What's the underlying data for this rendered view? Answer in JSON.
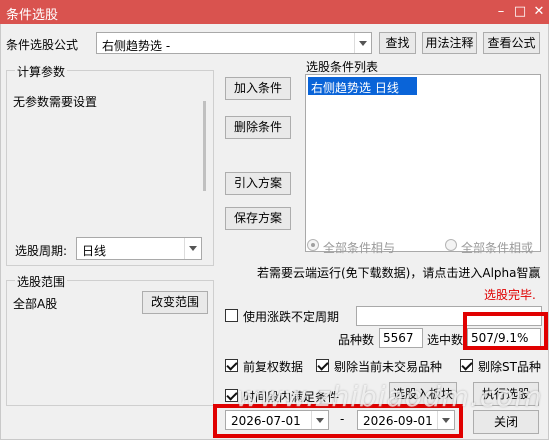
{
  "window": {
    "title": "条件选股",
    "minimize_glyph": "–",
    "maximize_glyph": "□",
    "close_glyph": "✕"
  },
  "formula": {
    "label": "条件选股公式",
    "selected": "右侧趋势选  -",
    "find_button": "查找",
    "usage_button": "用法注释",
    "view_button": "查看公式"
  },
  "params": {
    "group_title": "计算参数",
    "message": "无参数需要设置",
    "period_label": "选股周期:",
    "period_value": "日线"
  },
  "actions": {
    "add": "加入条件",
    "delete": "删除条件",
    "import": "引入方案",
    "save": "保存方案"
  },
  "condition_list": {
    "title": "选股条件列表",
    "items": [
      "右侧趋势选  日线"
    ]
  },
  "logic": {
    "all_and": "全部条件相与",
    "all_or": "全部条件相或"
  },
  "cloud_note": "若需要云端运行(免下载数据)，请点击进入Alpha智赢",
  "status": "选股完毕.",
  "range": {
    "group_title": "选股范围",
    "value": "全部A股",
    "change_button": "改变范围"
  },
  "options": {
    "uncertain_period_label": "使用涨跌不定周期",
    "uncertain_period_value": "",
    "count_label": "品种数",
    "count_value": "5567",
    "selected_label": "选中数",
    "selected_value": "507/9.1%",
    "fq_label": "前复权数据",
    "exclude_untraded_label": "剔除当前未交易品种",
    "exclude_st_label": "剔除ST品种",
    "time_cond_label": "时间段内满足条件",
    "to_block_button": "选股入板块",
    "run_button": "执行选股",
    "close_button": "关闭",
    "date_from": "2026-07-01",
    "date_sep": "-",
    "date_to": "2026-09-01"
  },
  "watermark": "www.zhibiaodm.com",
  "colors": {
    "titlebar": "#d9534f",
    "highlight": "#0a64d8",
    "status_red": "#e00000",
    "annotation_red": "#e00000"
  }
}
